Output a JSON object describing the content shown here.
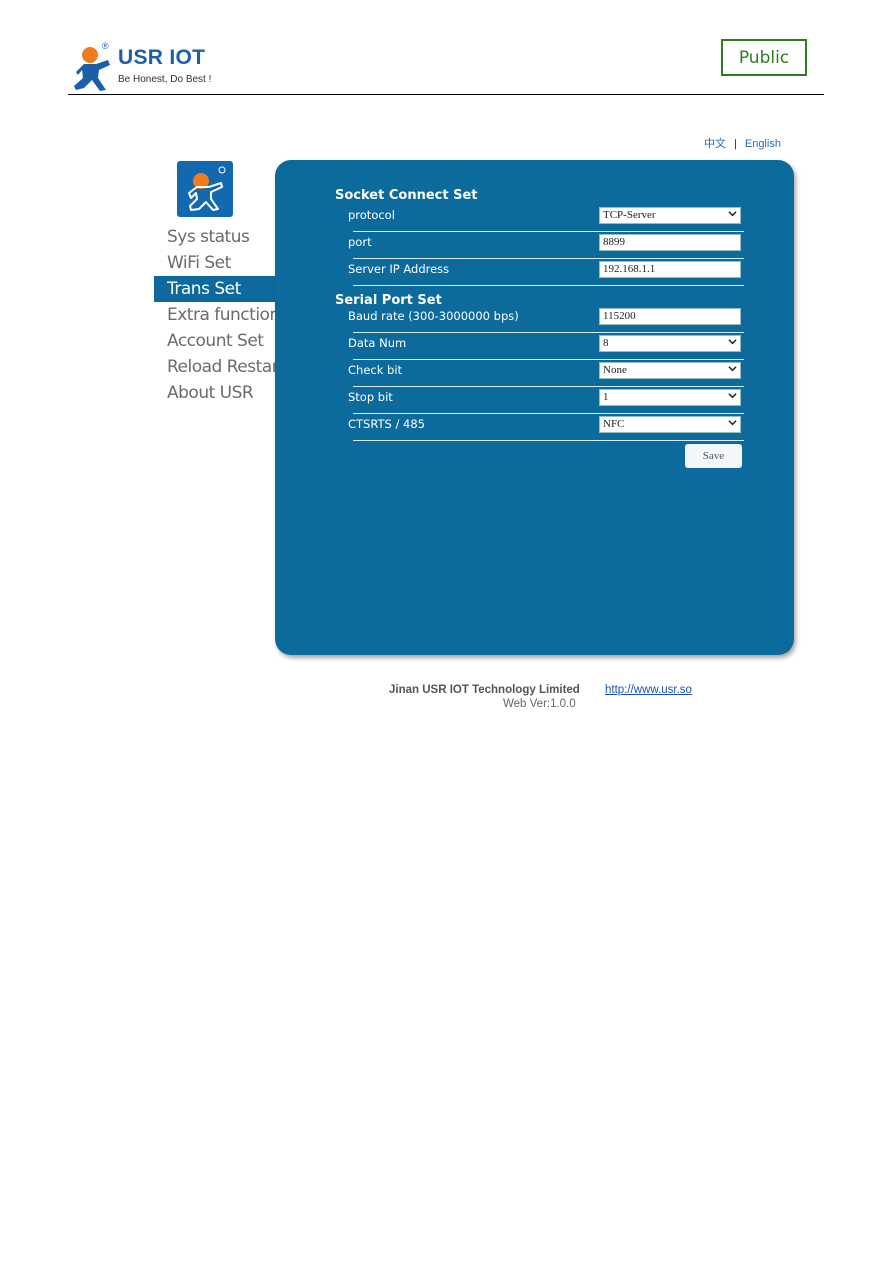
{
  "header": {
    "brand_name": "USR IOT",
    "brand_reg": "®",
    "tagline": "Be Honest, Do Best !",
    "classification_badge": "Public"
  },
  "language": {
    "options": [
      "中文",
      "English"
    ],
    "separator": "|"
  },
  "sidebar": {
    "logo_icon": "usr-mascot-logo",
    "items": [
      {
        "label": "Sys status",
        "active": false
      },
      {
        "label": "WiFi Set",
        "active": false
      },
      {
        "label": "Trans Set",
        "active": true
      },
      {
        "label": "Extra function",
        "active": false
      },
      {
        "label": "Account Set",
        "active": false
      },
      {
        "label": "Reload Restar",
        "active": false
      },
      {
        "label": "About USR",
        "active": false
      }
    ]
  },
  "panel": {
    "socket_section": {
      "title": "Socket Connect Set",
      "rows": [
        {
          "label": "protocol",
          "type": "select",
          "value": "TCP-Server"
        },
        {
          "label": "port",
          "type": "input",
          "value": "8899"
        },
        {
          "label": "Server IP Address",
          "type": "input",
          "value": "192.168.1.1"
        }
      ]
    },
    "serial_section": {
      "title": "Serial Port Set",
      "rows": [
        {
          "label": "Baud rate (300-3000000 bps)",
          "type": "input",
          "value": "115200"
        },
        {
          "label": "Data Num",
          "type": "select",
          "value": "8"
        },
        {
          "label": "Check bit",
          "type": "select",
          "value": "None"
        },
        {
          "label": "Stop bit",
          "type": "select",
          "value": "1"
        },
        {
          "label": "CTSRTS / 485",
          "type": "select",
          "value": "NFC"
        }
      ]
    },
    "save_label": "Save"
  },
  "footer": {
    "company": "Jinan USR IOT Technology Limited",
    "link": "http://www.usr.so",
    "version": "Web Ver:1.0.0"
  },
  "colors": {
    "panel": "#0c6b9c",
    "active_menu": "#0e6a9e",
    "brand_blue": "#1b5fa8",
    "brand_orange": "#f07c1e",
    "badge_green": "#2e7d1f"
  }
}
